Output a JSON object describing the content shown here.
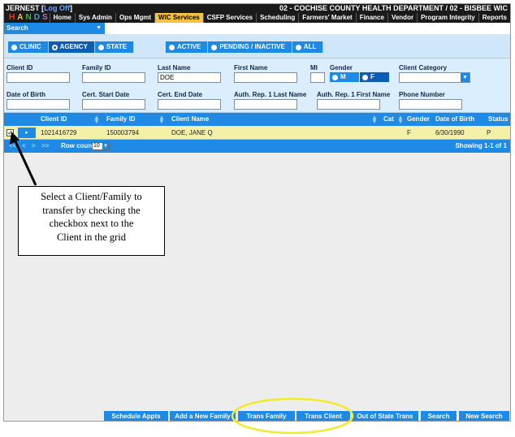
{
  "header": {
    "user": "JERNEST",
    "logout": "Log Off",
    "org": "02 - COCHISE COUNTY HEALTH DEPARTMENT / 02 - BISBEE WIC",
    "logo_letters": [
      "H",
      "A",
      "N",
      "D",
      "S"
    ],
    "logo_colors": [
      "#e53b2c",
      "#f5c242",
      "#3fb54a",
      "#3aa3f0",
      "#b36bd6"
    ]
  },
  "nav": {
    "items": [
      "Home",
      "Sys Admin",
      "Ops Mgmt",
      "WIC Services",
      "CSFP Services",
      "Scheduling",
      "Farmers' Market",
      "Finance",
      "Vendor",
      "Program Integrity",
      "Reports"
    ],
    "active": "WIC Services"
  },
  "search_tab": {
    "label": "Search"
  },
  "scope": {
    "clinic": "CLINIC",
    "agency": "AGENCY",
    "state": "STATE",
    "selected": "AGENCY"
  },
  "status": {
    "active": "ACTIVE",
    "pending": "PENDING / INACTIVE",
    "all": "ALL"
  },
  "criteria": {
    "client_id": {
      "label": "Client ID",
      "value": ""
    },
    "family_id": {
      "label": "Family ID",
      "value": ""
    },
    "last_name": {
      "label": "Last Name",
      "value": "DOE"
    },
    "first_name": {
      "label": "First Name",
      "value": ""
    },
    "mi": {
      "label": "MI",
      "value": ""
    },
    "gender": {
      "label": "Gender",
      "male": "M",
      "female": "F"
    },
    "client_category": {
      "label": "Client Category",
      "value": ""
    },
    "dob": {
      "label": "Date of Birth",
      "value": ""
    },
    "cert_start": {
      "label": "Cert. Start Date",
      "value": ""
    },
    "cert_end": {
      "label": "Cert. End Date",
      "value": ""
    },
    "auth_rep_last": {
      "label": "Auth. Rep. 1 Last Name",
      "value": ""
    },
    "auth_rep_first": {
      "label": "Auth. Rep. 1 First Name",
      "value": ""
    },
    "phone": {
      "label": "Phone Number",
      "value": ""
    }
  },
  "grid": {
    "columns": [
      "Client ID",
      "Family ID",
      "Client Name",
      "Cat",
      "Gender",
      "Date of Birth",
      "Status"
    ],
    "rows": [
      {
        "checked": true,
        "client_id": "1021416729",
        "family_id": "150003794",
        "client_name": "DOE, JANE Q",
        "cat": "",
        "gender": "F",
        "dob": "6/30/1990",
        "status": "P"
      }
    ],
    "pager": {
      "row_count_label": "Row count:",
      "row_count": "10",
      "showing": "Showing 1-1 of 1"
    }
  },
  "callout": {
    "lines": [
      "Select a Client/Family to",
      "transfer by checking the",
      "checkbox next to the",
      "Client in the grid"
    ]
  },
  "buttons": [
    "Schedule Appts",
    "Add a New Family",
    "Trans Family",
    "Trans Client",
    "Out of State Trans",
    "Search",
    "New Search"
  ],
  "highlight_color": "#f2ea2b"
}
